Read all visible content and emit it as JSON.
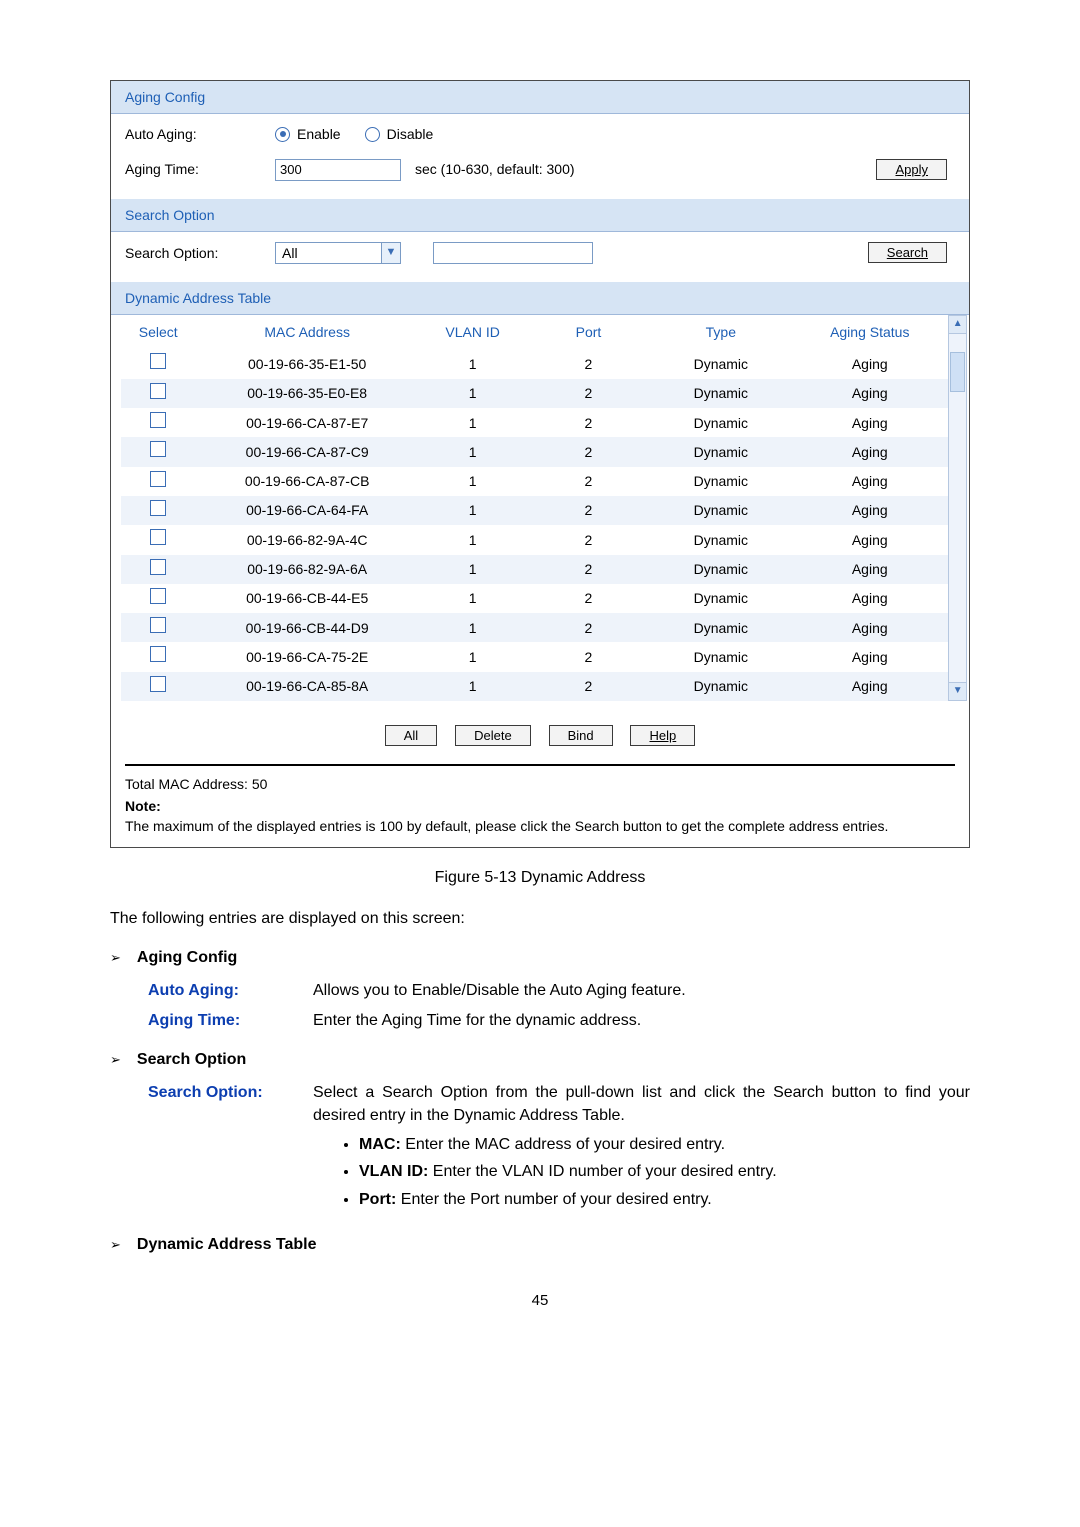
{
  "aging_config": {
    "header": "Aging Config",
    "auto_aging_label": "Auto Aging:",
    "enable": "Enable",
    "disable": "Disable",
    "aging_time_label": "Aging Time:",
    "aging_time_value": "300",
    "aging_time_hint": "sec (10-630, default: 300)",
    "apply": "Apply"
  },
  "search_option": {
    "header": "Search Option",
    "label": "Search Option:",
    "selected": "All",
    "value": "",
    "search": "Search"
  },
  "table": {
    "header": "Dynamic Address Table",
    "cols": {
      "select": "Select",
      "mac": "MAC Address",
      "vlan": "VLAN ID",
      "port": "Port",
      "type": "Type",
      "aging": "Aging Status"
    },
    "rows": [
      {
        "mac": "00-19-66-35-E1-50",
        "vlan": "1",
        "port": "2",
        "type": "Dynamic",
        "aging": "Aging"
      },
      {
        "mac": "00-19-66-35-E0-E8",
        "vlan": "1",
        "port": "2",
        "type": "Dynamic",
        "aging": "Aging"
      },
      {
        "mac": "00-19-66-CA-87-E7",
        "vlan": "1",
        "port": "2",
        "type": "Dynamic",
        "aging": "Aging"
      },
      {
        "mac": "00-19-66-CA-87-C9",
        "vlan": "1",
        "port": "2",
        "type": "Dynamic",
        "aging": "Aging"
      },
      {
        "mac": "00-19-66-CA-87-CB",
        "vlan": "1",
        "port": "2",
        "type": "Dynamic",
        "aging": "Aging"
      },
      {
        "mac": "00-19-66-CA-64-FA",
        "vlan": "1",
        "port": "2",
        "type": "Dynamic",
        "aging": "Aging"
      },
      {
        "mac": "00-19-66-82-9A-4C",
        "vlan": "1",
        "port": "2",
        "type": "Dynamic",
        "aging": "Aging"
      },
      {
        "mac": "00-19-66-82-9A-6A",
        "vlan": "1",
        "port": "2",
        "type": "Dynamic",
        "aging": "Aging"
      },
      {
        "mac": "00-19-66-CB-44-E5",
        "vlan": "1",
        "port": "2",
        "type": "Dynamic",
        "aging": "Aging"
      },
      {
        "mac": "00-19-66-CB-44-D9",
        "vlan": "1",
        "port": "2",
        "type": "Dynamic",
        "aging": "Aging"
      },
      {
        "mac": "00-19-66-CA-75-2E",
        "vlan": "1",
        "port": "2",
        "type": "Dynamic",
        "aging": "Aging"
      },
      {
        "mac": "00-19-66-CA-85-8A",
        "vlan": "1",
        "port": "2",
        "type": "Dynamic",
        "aging": "Aging"
      }
    ]
  },
  "actions": {
    "all": "All",
    "delete": "Delete",
    "bind": "Bind",
    "help": "Help"
  },
  "footer": {
    "total": "Total MAC Address: 50",
    "note_label": "Note:",
    "note_text": "The maximum of the displayed entries is 100 by default, please click the Search button to get the complete address entries."
  },
  "doc": {
    "figure_caption": "Figure 5-13 Dynamic Address",
    "intro": "The following entries are displayed on this screen:",
    "s1_title": "Aging Config",
    "s1_auto_term": "Auto Aging:",
    "s1_auto_def": "Allows you to Enable/Disable the Auto Aging feature.",
    "s1_time_term": "Aging Time:",
    "s1_time_def": "Enter the Aging Time for the dynamic address.",
    "s2_title": "Search Option",
    "s2_term": "Search Option:",
    "s2_def": "Select a Search Option from the pull-down list and click the Search button to find your desired entry in the Dynamic Address Table.",
    "bullets": {
      "mac_b": "MAC:",
      "mac_t": " Enter the MAC address of your desired entry.",
      "vlan_b": "VLAN ID:",
      "vlan_t": " Enter the VLAN ID number of your desired entry.",
      "port_b": "Port:",
      "port_t": " Enter the Port number of your desired entry."
    },
    "s3_title": "Dynamic Address Table",
    "page_number": "45"
  }
}
